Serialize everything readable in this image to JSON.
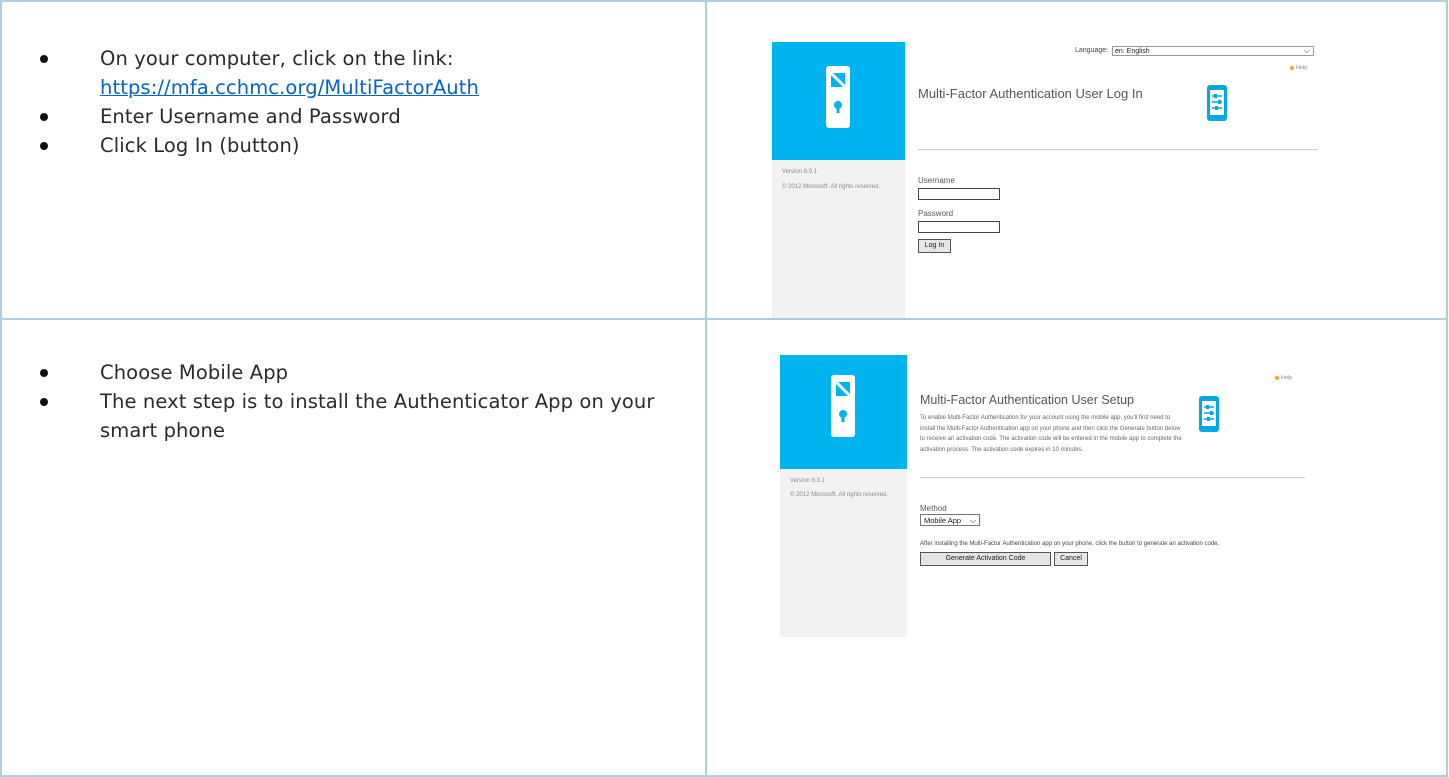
{
  "rows": [
    {
      "bullets": [
        {
          "prefix": "On your computer, click on the link:",
          "link": "https://mfa.cchmc.org/MultiFactorAuth"
        },
        {
          "text": "Enter Username and Password"
        },
        {
          "text": "Click Log In (button)"
        }
      ],
      "screenshot": {
        "language_label": "Language:",
        "language_value": "en: English",
        "help": "Help",
        "title": "Multi-Factor Authentication User Log In",
        "version": "Version 8.0.1",
        "copyright": "© 2012 Microsoft. All rights reserved.",
        "username_label": "Username",
        "password_label": "Password",
        "login_button": "Log In"
      }
    },
    {
      "bullets": [
        {
          "text": "Choose Mobile App"
        },
        {
          "text": "The next step is to install the Authenticator App on your smart phone"
        }
      ],
      "screenshot": {
        "help": "Help",
        "title": "Multi-Factor Authentication User Setup",
        "description": "To enable Multi-Factor Authentication for your account using the mobile app, you'll first need to install the Multi-Factor Authentication app on your phone and then click the Generate button below to receive an activation code. The activation code will be entered in the mobile app to complete the activation process. The activation code expires in 10 minutes.",
        "version": "Version 8.0.1",
        "copyright": "© 2012 Microsoft. All rights reserved.",
        "method_label": "Method",
        "method_value": "Mobile App",
        "instruction": "After installing the Multi-Factor Authentication app on your phone, click the button to generate an activation code.",
        "generate_button": "Generate Activation Code",
        "cancel_button": "Cancel"
      }
    }
  ]
}
